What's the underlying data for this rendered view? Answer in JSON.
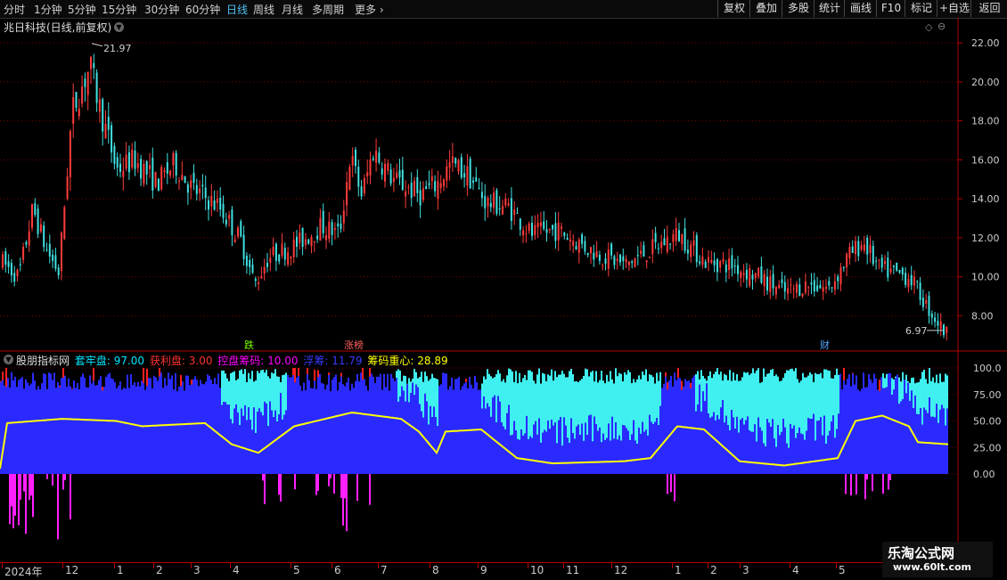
{
  "toolbar": {
    "timeframes": [
      {
        "label": "分时",
        "active": false
      },
      {
        "label": "1分钟",
        "active": false
      },
      {
        "label": "5分钟",
        "active": false
      },
      {
        "label": "15分钟",
        "active": false
      },
      {
        "label": "30分钟",
        "active": false
      },
      {
        "label": "60分钟",
        "active": false
      },
      {
        "label": "日线",
        "active": true
      },
      {
        "label": "周线",
        "active": false
      },
      {
        "label": "月线",
        "active": false
      },
      {
        "label": "多周期",
        "active": false
      },
      {
        "label": "更多",
        "active": false
      }
    ],
    "right_buttons": [
      "复权",
      "叠加",
      "多股",
      "统计",
      "画线",
      "F10",
      "标记",
      "+自选",
      "返回"
    ]
  },
  "stock": {
    "title": "兆日科技(日线,前复权)"
  },
  "price_axis": {
    "labels": [
      "22.00",
      "20.00",
      "18.00",
      "16.00",
      "14.00",
      "12.00",
      "10.00",
      "8.00"
    ],
    "min": 6.6,
    "max": 22.6
  },
  "price_markers": {
    "high": "21.97",
    "low": "6.97"
  },
  "event_tags": [
    {
      "text": "跌",
      "color": "#7cfc00"
    },
    {
      "text": "涨榜",
      "color": "#ff6060"
    },
    {
      "text": "财",
      "color": "#4fa3ff"
    }
  ],
  "indicator": {
    "name": "股朋指标网",
    "items": [
      {
        "label": "套牢盘: 97.00",
        "color": "#00e5ff"
      },
      {
        "label": "获利盘: 3.00",
        "color": "#ff3030"
      },
      {
        "label": "控盘筹码: 10.00",
        "color": "#ff00ff"
      },
      {
        "label": "浮筹: 11.79",
        "color": "#3a3aff"
      },
      {
        "label": "筹码重心: 28.89",
        "color": "#ffff00"
      }
    ],
    "axis_labels": [
      "100.0",
      "75.00",
      "50.00",
      "25.00",
      "0.00"
    ]
  },
  "date_axis": {
    "labels": [
      "2024年",
      "12",
      "1",
      "2",
      "3",
      "4",
      "5",
      "6",
      "7",
      "8",
      "9",
      "10",
      "11",
      "12",
      "1",
      "2",
      "3",
      "4",
      "5"
    ]
  },
  "watermark": {
    "title": "乐淘公式网",
    "url": "www.60lt.com"
  },
  "colors": {
    "up": "#ff3b3b",
    "down": "#40e0e0",
    "grid": "#7a0000",
    "axis": "#b00000"
  }
}
